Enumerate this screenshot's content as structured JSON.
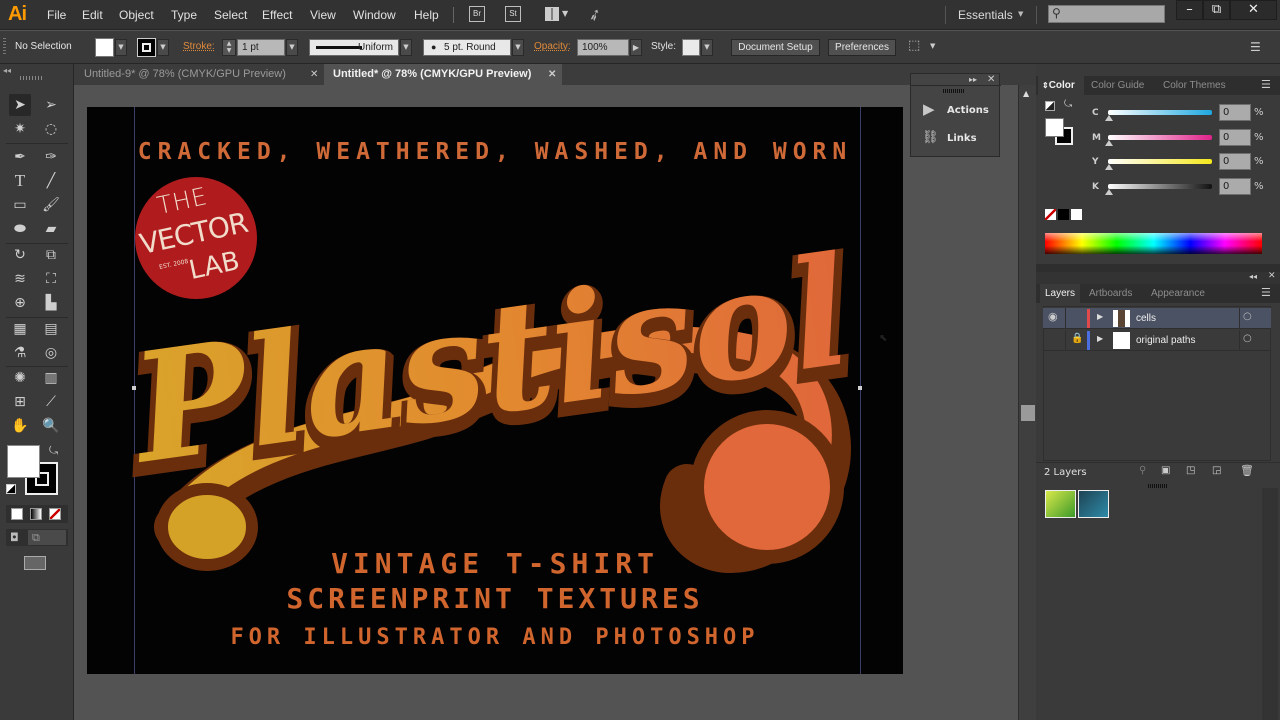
{
  "app": {
    "logo": "Ai"
  },
  "menubar": {
    "items": [
      "File",
      "Edit",
      "Object",
      "Type",
      "Select",
      "Effect",
      "View",
      "Window",
      "Help"
    ],
    "bridge": "Br",
    "stock": "St",
    "workspace": "Essentials",
    "search_placeholder": "",
    "window_controls": {
      "minimize": "–",
      "restore": "⧉",
      "close": "✕"
    }
  },
  "controlbar": {
    "selection": "No Selection",
    "stroke_label": "Stroke:",
    "stroke_weight": "1 pt",
    "profile": "Uniform",
    "brush": "5 pt. Round",
    "opacity_label": "Opacity:",
    "opacity": "100%",
    "style_label": "Style:",
    "document_setup": "Document Setup",
    "preferences": "Preferences"
  },
  "tabs": [
    {
      "label": "Untitled-9* @ 78% (CMYK/GPU Preview)",
      "active": false
    },
    {
      "label": "Untitled* @ 78% (CMYK/GPU Preview)",
      "active": true
    }
  ],
  "float_panel": {
    "items": [
      {
        "icon": "play-icon",
        "label": "Actions"
      },
      {
        "icon": "link-icon",
        "label": "Links"
      }
    ]
  },
  "color_panel": {
    "tabs": [
      "Color",
      "Color Guide",
      "Color Themes"
    ],
    "active_tab": "Color",
    "channels": [
      {
        "label": "C",
        "value": "0",
        "unit": "%",
        "color": "#1ea8e0"
      },
      {
        "label": "M",
        "value": "0",
        "unit": "%",
        "color": "#e0228a"
      },
      {
        "label": "Y",
        "value": "0",
        "unit": "%",
        "color": "#f5e81c"
      },
      {
        "label": "K",
        "value": "0",
        "unit": "%",
        "color": "#111111"
      }
    ]
  },
  "layers_panel": {
    "tabs": [
      "Layers",
      "Artboards",
      "Appearance"
    ],
    "active_tab": "Layers",
    "layers": [
      {
        "name": "cells",
        "color": "#e04a4a",
        "visible": true,
        "locked": false,
        "selected": true
      },
      {
        "name": "original paths",
        "color": "#4a6ee0",
        "visible": false,
        "locked": true,
        "selected": false
      }
    ],
    "count_label": "2 Layers"
  },
  "artwork": {
    "tagline": "CRACKED, WEATHERED, WASHED, AND WORN",
    "badge_line1": "THE",
    "badge_line2": "VECTOR",
    "badge_line3": "LAB",
    "badge_est": "EST. 2008",
    "title": "Plastisol",
    "subtitle1": "VINTAGE T-SHIRT",
    "subtitle2": "SCREENPRINT TEXTURES",
    "subtitle3": "FOR ILLUSTRATOR AND PHOTOSHOP"
  }
}
